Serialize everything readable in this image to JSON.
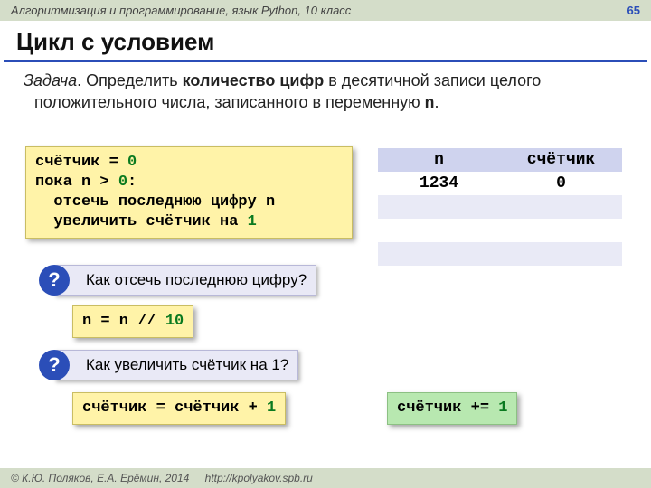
{
  "header": {
    "course": "Алгоритмизация и программирование, язык Python, 10 класс",
    "page": "65"
  },
  "title": "Цикл с условием",
  "task": {
    "label": "Задача",
    "before": ". Определить ",
    "bold": "количество цифр",
    "mid": " в десятичной записи целого положительного числа, записанного в переменную ",
    "var": "n",
    "after": "."
  },
  "code_main": {
    "l1a": "счётчик = ",
    "l1n": "0",
    "l2a": "пока n > ",
    "l2n": "0",
    "l2b": ":",
    "l3": "  отсечь последнюю цифру n",
    "l4a": "  увеличить счётчик на ",
    "l4n": "1"
  },
  "table": {
    "h1": "n",
    "h2": "счётчик",
    "r1c1": "1234",
    "r1c2": "0"
  },
  "q1": {
    "badge": "?",
    "text": "Как отсечь последнюю цифру?"
  },
  "code_cut": {
    "a": "n = n // ",
    "n": "10"
  },
  "q2": {
    "badge": "?",
    "text": "Как увеличить счётчик на 1?"
  },
  "code_inc1": {
    "a": "счётчик = счётчик + ",
    "n": "1"
  },
  "code_inc2": {
    "a": "счётчик += ",
    "n": "1"
  },
  "footer": {
    "copyright": "© К.Ю. Поляков, Е.А. Ерёмин, 2014",
    "url": "http://kpolyakov.spb.ru"
  }
}
